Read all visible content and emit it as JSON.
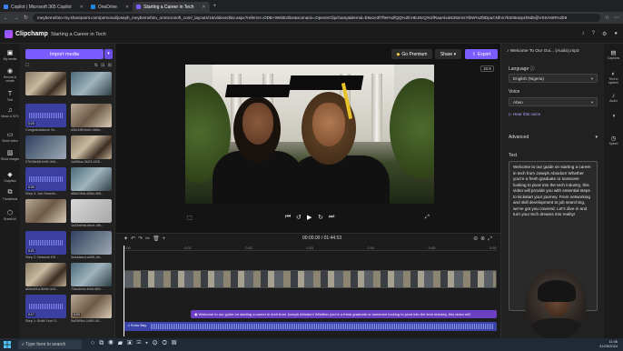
{
  "browser": {
    "tabs": [
      {
        "label": "Copilot | Microsoft 365 Copilot",
        "active": false
      },
      {
        "label": "OneDrive",
        "active": false
      },
      {
        "label": "Starting a Career in Tech",
        "active": true
      }
    ],
    "url": "meybemefoto-my.sharepoint.com/personal/joseph_meybemefoto_onmicrosoft_com/_layouts/15/videoeditor.aspx?referrer=ODB+WebEditor&scenario=OpenInClipchamp&itemid=b9a1e3f7f9e%2fQQ%2fcHEJ8cQ%2fRaaAlvaN3SsmsYlbW%2f8DpuCNfnn7kS06raty4h9d5@VStVn0R%2b9"
  },
  "app": {
    "name": "Clipchamp",
    "project": "Starting a Career in Tech",
    "header_icons": [
      "bell-icon",
      "help-icon",
      "settings-icon",
      "avatar"
    ]
  },
  "nav": [
    {
      "label": "My media",
      "icon": "folder-icon",
      "active": true
    },
    {
      "label": "Record & create",
      "icon": "record-icon"
    },
    {
      "label": "Text",
      "icon": "text-icon"
    },
    {
      "label": "Music & SFX",
      "icon": "music-icon"
    },
    {
      "label": "Stock video",
      "icon": "stock-video-icon"
    },
    {
      "label": "Stock images",
      "icon": "stock-images-icon"
    },
    {
      "label": "Graphics",
      "icon": "graphics-icon"
    },
    {
      "label": "Transitions",
      "icon": "transitions-icon"
    },
    {
      "label": "Brand kit",
      "icon": "brand-kit-icon"
    }
  ],
  "media": {
    "import_label": "Import media",
    "items": [
      {
        "label": "",
        "duration": "",
        "kind": "photo1"
      },
      {
        "label": "",
        "duration": "",
        "kind": "photo2"
      },
      {
        "label": "Congratulations Yo...",
        "duration": "0:20",
        "kind": "audio"
      },
      {
        "label": "d3fe1f8f-feeb-4b6e...",
        "duration": "",
        "kind": "photo3"
      },
      {
        "label": "07b08e68-fe89-4b6...",
        "duration": "",
        "kind": "photo4"
      },
      {
        "label": "1a58fca-3b23-4f26...",
        "duration": "",
        "kind": "photo1"
      },
      {
        "label": "Step 3: Job Searchi...",
        "duration": "0:20",
        "kind": "audio"
      },
      {
        "label": "d8fa23b8-d58d-4b5...",
        "duration": "",
        "kind": "photo2"
      },
      {
        "label": "",
        "duration": "",
        "kind": "photo3"
      },
      {
        "label": "1a15a9da-dbc4-4fb...",
        "duration": "",
        "kind": "gray"
      },
      {
        "label": "Step 2: Network Eff...",
        "duration": "0:21",
        "kind": "audio"
      },
      {
        "label": "3a4a6acd-a058-4b...",
        "duration": "",
        "kind": "photo4"
      },
      {
        "label": "a06a4f1a-5e9d-4c3...",
        "duration": "",
        "kind": "photo1"
      },
      {
        "label": "73ac6e4c-fc5d-469...",
        "duration": "",
        "kind": "photo2"
      },
      {
        "label": "Step 1: Build Your S...",
        "duration": "0:17",
        "kind": "audio"
      },
      {
        "label": "5a05f9bc-1469-40...",
        "duration": "0:20",
        "kind": "photo3"
      }
    ]
  },
  "preview": {
    "premium_label": "Go Premium",
    "share_label": "Share",
    "export_label": "Export",
    "ratio": "16:9",
    "timecode": "00:00.00 / 01:44.53"
  },
  "timeline": {
    "ruler": [
      "0:00",
      "0:01",
      "0:02",
      "0:03",
      "0:04",
      "0:05",
      "0:06"
    ],
    "text_clip": "Welcome to our guide on starting a career in tech from Joseph Abiodun! Whether you're a fresh graduate or someone looking to pivot into the tech industry, this video will",
    "audio_clip": "Echo Bay"
  },
  "properties": {
    "title": "Welcome To Our Gui... (Audio).mp3",
    "language_label": "Language",
    "language_value": "English (Nigeria)",
    "voice_label": "Voice",
    "voice_value": "Abeo",
    "hear_voice": "Hear this voice",
    "advanced_label": "Advanced",
    "text_label": "Text",
    "text_value": "Welcome to our guide on starting a career in tech from Joseph Abiodun! Whether you're a fresh graduate or someone looking to pivot into the tech industry, this video will provide you with essential steps to kickstart your journey. From networking and skill development to job searching, we've got you covered. Let's dive in and turn your tech dreams into reality!"
  },
  "right_rail": [
    {
      "label": "Captions",
      "icon": "captions-icon"
    },
    {
      "label": "Text to speech",
      "icon": "speech-icon"
    },
    {
      "label": "Audio",
      "icon": "audio-icon"
    },
    {
      "label": "",
      "icon": "fade-icon"
    },
    {
      "label": "Speed",
      "icon": "speed-icon"
    }
  ],
  "taskbar": {
    "search_placeholder": "Type here to search",
    "time": "11:06",
    "date": "31/05/2024"
  }
}
